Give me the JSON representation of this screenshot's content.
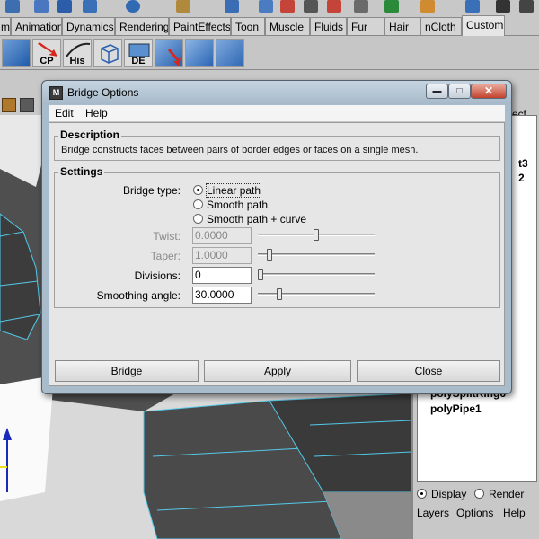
{
  "maya": {
    "shelf_tabs": [
      "m",
      "Animation",
      "Dynamics",
      "Rendering",
      "PaintEffects",
      "Toon",
      "Muscle",
      "Fluids",
      "Fur",
      "Hair",
      "nCloth",
      "Custom"
    ],
    "shelf_icons": [
      {
        "label": "",
        "icon": "bridge-shelf-icon"
      },
      {
        "label": "CP",
        "icon": "cp-shelf-icon"
      },
      {
        "label": "His",
        "icon": "history-shelf-icon"
      },
      {
        "label": "",
        "icon": "cube-wire-shelf-icon"
      },
      {
        "label": "DE",
        "icon": "delete-edge-shelf-icon"
      },
      {
        "label": "",
        "icon": "extrude-shelf-icon"
      },
      {
        "label": "",
        "icon": "smooth-shelf-icon"
      },
      {
        "label": "",
        "icon": "merge-shelf-icon"
      }
    ],
    "outliner": {
      "partial_right": [
        "ect",
        "t3",
        "2"
      ],
      "items": [
        "polySplitRing6",
        "polyPipe1"
      ]
    },
    "layers": {
      "display_label": "Display",
      "render_label": "Render",
      "menu": [
        "Layers",
        "Options",
        "Help"
      ]
    }
  },
  "dialog": {
    "title": "Bridge Options",
    "menu": [
      "Edit",
      "Help"
    ],
    "description": {
      "heading": "Description",
      "text": "Bridge constructs faces between pairs of border edges or faces on a single mesh."
    },
    "settings": {
      "heading": "Settings",
      "bridge_type_label": "Bridge type:",
      "bridge_types": [
        "Linear path",
        "Smooth path",
        "Smooth path + curve"
      ],
      "selected_bridge_type": "Linear path",
      "twist": {
        "label": "Twist:",
        "value": "0.0000",
        "enabled": false,
        "slider_fraction": 0.5
      },
      "taper": {
        "label": "Taper:",
        "value": "1.0000",
        "enabled": false,
        "slider_fraction": 0.08
      },
      "divisions": {
        "label": "Divisions:",
        "value": "0",
        "enabled": true,
        "slider_fraction": 0.0
      },
      "smoothing_angle": {
        "label": "Smoothing angle:",
        "value": "30.0000",
        "enabled": true,
        "slider_fraction": 0.17
      }
    },
    "buttons": {
      "bridge": "Bridge",
      "apply": "Apply",
      "close": "Close"
    }
  }
}
